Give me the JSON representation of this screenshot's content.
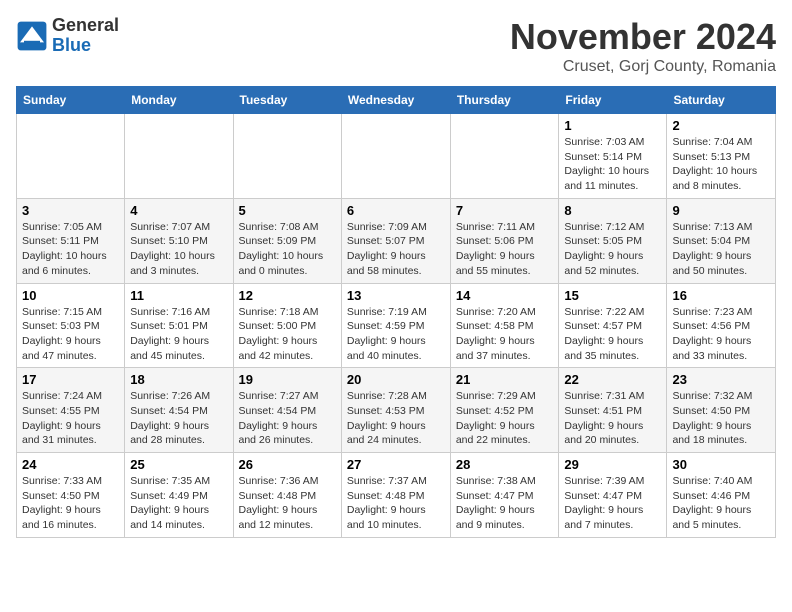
{
  "header": {
    "logo_general": "General",
    "logo_blue": "Blue",
    "month_title": "November 2024",
    "location": "Cruset, Gorj County, Romania"
  },
  "weekdays": [
    "Sunday",
    "Monday",
    "Tuesday",
    "Wednesday",
    "Thursday",
    "Friday",
    "Saturday"
  ],
  "weeks": [
    [
      {
        "day": "",
        "info": ""
      },
      {
        "day": "",
        "info": ""
      },
      {
        "day": "",
        "info": ""
      },
      {
        "day": "",
        "info": ""
      },
      {
        "day": "",
        "info": ""
      },
      {
        "day": "1",
        "info": "Sunrise: 7:03 AM\nSunset: 5:14 PM\nDaylight: 10 hours and 11 minutes."
      },
      {
        "day": "2",
        "info": "Sunrise: 7:04 AM\nSunset: 5:13 PM\nDaylight: 10 hours and 8 minutes."
      }
    ],
    [
      {
        "day": "3",
        "info": "Sunrise: 7:05 AM\nSunset: 5:11 PM\nDaylight: 10 hours and 6 minutes."
      },
      {
        "day": "4",
        "info": "Sunrise: 7:07 AM\nSunset: 5:10 PM\nDaylight: 10 hours and 3 minutes."
      },
      {
        "day": "5",
        "info": "Sunrise: 7:08 AM\nSunset: 5:09 PM\nDaylight: 10 hours and 0 minutes."
      },
      {
        "day": "6",
        "info": "Sunrise: 7:09 AM\nSunset: 5:07 PM\nDaylight: 9 hours and 58 minutes."
      },
      {
        "day": "7",
        "info": "Sunrise: 7:11 AM\nSunset: 5:06 PM\nDaylight: 9 hours and 55 minutes."
      },
      {
        "day": "8",
        "info": "Sunrise: 7:12 AM\nSunset: 5:05 PM\nDaylight: 9 hours and 52 minutes."
      },
      {
        "day": "9",
        "info": "Sunrise: 7:13 AM\nSunset: 5:04 PM\nDaylight: 9 hours and 50 minutes."
      }
    ],
    [
      {
        "day": "10",
        "info": "Sunrise: 7:15 AM\nSunset: 5:03 PM\nDaylight: 9 hours and 47 minutes."
      },
      {
        "day": "11",
        "info": "Sunrise: 7:16 AM\nSunset: 5:01 PM\nDaylight: 9 hours and 45 minutes."
      },
      {
        "day": "12",
        "info": "Sunrise: 7:18 AM\nSunset: 5:00 PM\nDaylight: 9 hours and 42 minutes."
      },
      {
        "day": "13",
        "info": "Sunrise: 7:19 AM\nSunset: 4:59 PM\nDaylight: 9 hours and 40 minutes."
      },
      {
        "day": "14",
        "info": "Sunrise: 7:20 AM\nSunset: 4:58 PM\nDaylight: 9 hours and 37 minutes."
      },
      {
        "day": "15",
        "info": "Sunrise: 7:22 AM\nSunset: 4:57 PM\nDaylight: 9 hours and 35 minutes."
      },
      {
        "day": "16",
        "info": "Sunrise: 7:23 AM\nSunset: 4:56 PM\nDaylight: 9 hours and 33 minutes."
      }
    ],
    [
      {
        "day": "17",
        "info": "Sunrise: 7:24 AM\nSunset: 4:55 PM\nDaylight: 9 hours and 31 minutes."
      },
      {
        "day": "18",
        "info": "Sunrise: 7:26 AM\nSunset: 4:54 PM\nDaylight: 9 hours and 28 minutes."
      },
      {
        "day": "19",
        "info": "Sunrise: 7:27 AM\nSunset: 4:54 PM\nDaylight: 9 hours and 26 minutes."
      },
      {
        "day": "20",
        "info": "Sunrise: 7:28 AM\nSunset: 4:53 PM\nDaylight: 9 hours and 24 minutes."
      },
      {
        "day": "21",
        "info": "Sunrise: 7:29 AM\nSunset: 4:52 PM\nDaylight: 9 hours and 22 minutes."
      },
      {
        "day": "22",
        "info": "Sunrise: 7:31 AM\nSunset: 4:51 PM\nDaylight: 9 hours and 20 minutes."
      },
      {
        "day": "23",
        "info": "Sunrise: 7:32 AM\nSunset: 4:50 PM\nDaylight: 9 hours and 18 minutes."
      }
    ],
    [
      {
        "day": "24",
        "info": "Sunrise: 7:33 AM\nSunset: 4:50 PM\nDaylight: 9 hours and 16 minutes."
      },
      {
        "day": "25",
        "info": "Sunrise: 7:35 AM\nSunset: 4:49 PM\nDaylight: 9 hours and 14 minutes."
      },
      {
        "day": "26",
        "info": "Sunrise: 7:36 AM\nSunset: 4:48 PM\nDaylight: 9 hours and 12 minutes."
      },
      {
        "day": "27",
        "info": "Sunrise: 7:37 AM\nSunset: 4:48 PM\nDaylight: 9 hours and 10 minutes."
      },
      {
        "day": "28",
        "info": "Sunrise: 7:38 AM\nSunset: 4:47 PM\nDaylight: 9 hours and 9 minutes."
      },
      {
        "day": "29",
        "info": "Sunrise: 7:39 AM\nSunset: 4:47 PM\nDaylight: 9 hours and 7 minutes."
      },
      {
        "day": "30",
        "info": "Sunrise: 7:40 AM\nSunset: 4:46 PM\nDaylight: 9 hours and 5 minutes."
      }
    ]
  ]
}
